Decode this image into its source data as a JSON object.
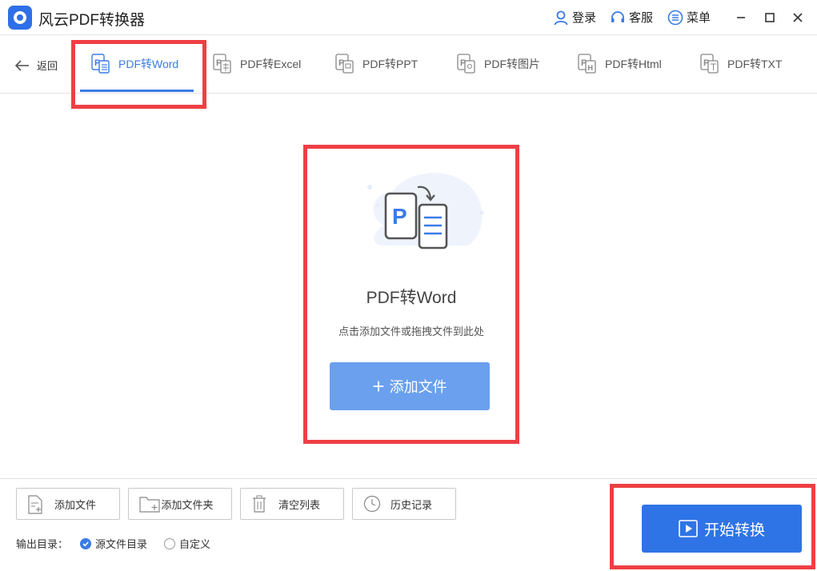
{
  "app": {
    "title": "风云PDF转换器"
  },
  "titlebar": {
    "login": "登录",
    "service": "客服",
    "menu": "菜单"
  },
  "nav": {
    "back": "返回",
    "tabs": [
      {
        "label": "PDF转Word",
        "icon": "pdf-to-word-icon",
        "active": true
      },
      {
        "label": "PDF转Excel",
        "icon": "pdf-to-excel-icon"
      },
      {
        "label": "PDF转PPT",
        "icon": "pdf-to-ppt-icon"
      },
      {
        "label": "PDF转图片",
        "icon": "pdf-to-image-icon"
      },
      {
        "label": "PDF转Html",
        "icon": "pdf-to-html-icon"
      },
      {
        "label": "PDF转TXT",
        "icon": "pdf-to-txt-icon"
      }
    ]
  },
  "drop": {
    "title": "PDF转Word",
    "hint": "点击添加文件或拖拽文件到此处",
    "add_button": "添加文件",
    "add_icon": "+"
  },
  "toolbar": {
    "add_file": "添加文件",
    "add_folder": "添加文件夹",
    "clear_list": "清空列表",
    "history": "历史记录"
  },
  "output": {
    "label": "输出目录：",
    "options": [
      {
        "label": "源文件目录",
        "selected": true
      },
      {
        "label": "自定义",
        "selected": false
      }
    ]
  },
  "start_button": "开始转换",
  "colors": {
    "accent": "#2f74e6",
    "highlight": "#ef3f44",
    "add_button": "#6aa0ee"
  }
}
